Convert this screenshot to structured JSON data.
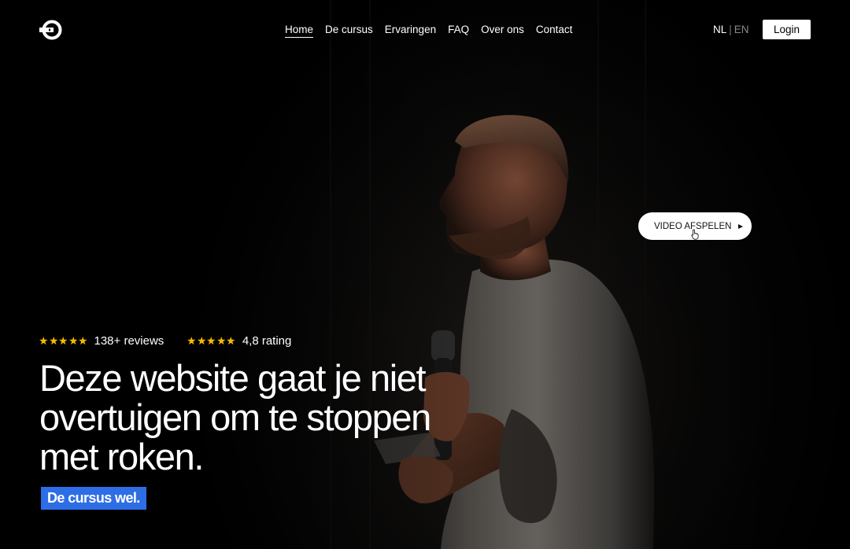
{
  "header": {
    "logo_name": "logo-icon",
    "nav": [
      {
        "label": "Home",
        "active": true
      },
      {
        "label": "De cursus",
        "active": false
      },
      {
        "label": "Ervaringen",
        "active": false
      },
      {
        "label": "FAQ",
        "active": false
      },
      {
        "label": "Over ons",
        "active": false
      },
      {
        "label": "Contact",
        "active": false
      }
    ],
    "lang": {
      "current": "NL",
      "separator": "|",
      "other": "EN"
    },
    "login_label": "Login"
  },
  "hero": {
    "video_button_label": "VIDEO AFSPELEN",
    "ratings": [
      {
        "stars": 5,
        "text": "138+ reviews"
      },
      {
        "stars": 5,
        "text": "4,8 rating"
      }
    ],
    "headline_lines": [
      "Deze website gaat je niet",
      "overtuigen om te stoppen",
      "met roken."
    ],
    "cta_label": "De cursus wel."
  },
  "colors": {
    "background": "#000000",
    "star": "#f5b800",
    "cta_bg": "#2d6ee6",
    "text": "#ffffff"
  }
}
